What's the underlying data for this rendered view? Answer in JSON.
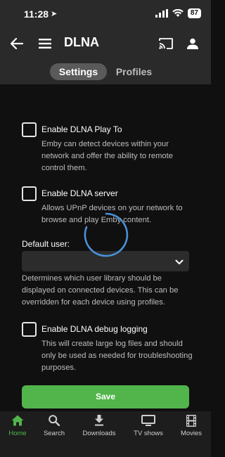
{
  "status_bar": {
    "time": "11:28",
    "battery": "87"
  },
  "app_bar": {
    "title": "DLNA",
    "tabs": [
      {
        "label": "Settings",
        "active": true
      },
      {
        "label": "Profiles",
        "active": false
      }
    ]
  },
  "settings": {
    "play_to": {
      "label": "Enable DLNA Play To",
      "checked": false,
      "help": "Emby can detect devices within your network and offer the ability to remote control them."
    },
    "server": {
      "label": "Enable DLNA server",
      "checked": false,
      "help": "Allows UPnP devices on your network to browse and play Emby content."
    },
    "default_user": {
      "label": "Default user:",
      "value": "",
      "help": "Determines which user library should be displayed on connected devices. This can be overridden for each device using profiles."
    },
    "debug_logging": {
      "label": "Enable DLNA debug logging",
      "checked": false,
      "help": "This will create large log files and should only be used as needed for troubleshooting purposes."
    },
    "save_label": "Save"
  },
  "bottom_nav": [
    {
      "label": "Home",
      "icon": "home-icon",
      "active": true
    },
    {
      "label": "Search",
      "icon": "search-icon",
      "active": false
    },
    {
      "label": "Downloads",
      "icon": "download-icon",
      "active": false
    },
    {
      "label": "TV shows",
      "icon": "tv-icon",
      "active": false
    },
    {
      "label": "Movies",
      "icon": "movie-icon",
      "active": false
    }
  ],
  "colors": {
    "accent": "#52b54b",
    "spinner": "#4a90d9",
    "background": "#101010",
    "header": "#2a2a2a"
  }
}
